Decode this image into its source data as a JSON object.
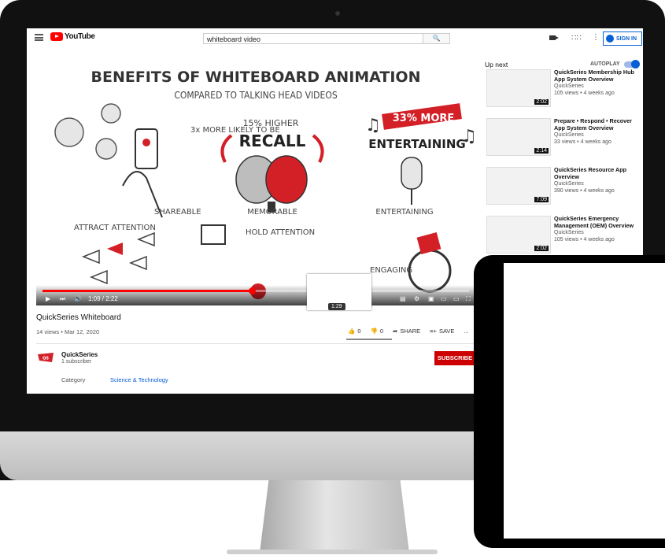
{
  "browser": {
    "logo_text": "YouTube",
    "search_value": "whiteboard video",
    "sign_in_label": "SIGN IN"
  },
  "video": {
    "headline": "BENEFITS OF WHITEBOARD ANIMATION",
    "subheadline": "COMPARED TO TALKING HEAD VIDEOS",
    "panels": [
      {
        "caption": "3x MORE LIKELY TO BE",
        "label": "SHAREABLE"
      },
      {
        "caption": "15% HIGHER",
        "banner": "RECALL",
        "label": "MEMORABLE"
      },
      {
        "caption": "33% MORE",
        "banner": "ENTERTAINING",
        "label": "ENTERTAINING"
      },
      {
        "label": "ATTRACT ATTENTION"
      },
      {
        "label": "HOLD ATTENTION"
      },
      {
        "label": "ENGAGING"
      }
    ],
    "time_display": "1:09 / 2:22",
    "hover_time": "1:29",
    "progress_fraction": 0.49,
    "title": "QuickSeries Whiteboard",
    "views_date": "14 views • Mar 12, 2020",
    "likes": "0",
    "dislikes": "0",
    "share_label": "SHARE",
    "save_label": "SAVE",
    "more_label": "..."
  },
  "channel": {
    "name": "QuickSeries",
    "subscribers": "1 subscriber",
    "subscribe_label": "SUBSCRIBE",
    "category_label": "Category",
    "category_value": "Science & Technology"
  },
  "sidebar": {
    "up_next_label": "Up next",
    "autoplay_label": "AUTOPLAY",
    "recommendations": [
      {
        "title": "QuickSeries Membership Hub App System Overview",
        "channel": "QuickSeries",
        "meta": "105 views • 4 weeks ago",
        "duration": "2:02"
      },
      {
        "title": "Prepare • Respond • Recover App System Overview",
        "channel": "QuickSeries",
        "meta": "33 views • 4 weeks ago",
        "duration": "2:14"
      },
      {
        "title": "QuickSeries Resource App Overview",
        "channel": "QuickSeries",
        "meta": "390 views • 4 weeks ago",
        "duration": "7:09"
      },
      {
        "title": "QuickSeries Emergency Management (OEM) Overview",
        "channel": "QuickSeries",
        "meta": "105 views • 4 weeks ago",
        "duration": "2:02"
      }
    ]
  },
  "colors": {
    "brand_red": "#ff0000",
    "link_blue": "#065fd4",
    "subscribe_red": "#cc0000",
    "illustration_red": "#d32027"
  }
}
